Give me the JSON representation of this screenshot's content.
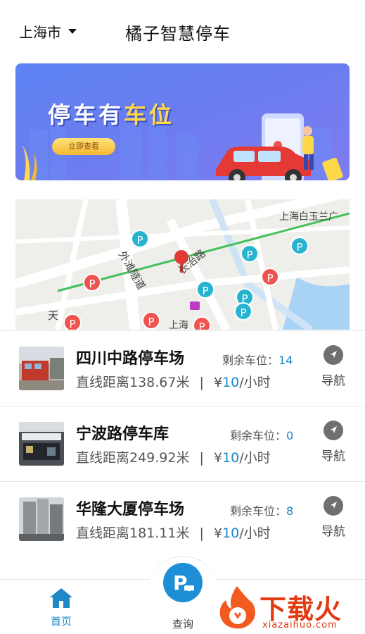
{
  "header": {
    "city": "上海市",
    "title": "橘子智慧停车"
  },
  "banner": {
    "title_part1": "停车有",
    "title_part2": "车位",
    "button": "立即查看"
  },
  "map": {
    "labels": [
      "上海白玉兰广",
      "长治路",
      "外滩隧道",
      "天",
      "上海"
    ]
  },
  "parking_list": [
    {
      "name": "四川中路停车场",
      "distance": "直线距离138.67米",
      "separator": "|",
      "price_prefix": "¥",
      "price": "10",
      "price_unit": "/小时",
      "avail_label": "剩余车位：",
      "avail_value": "14",
      "nav_label": "导航"
    },
    {
      "name": "宁波路停车库",
      "distance": "直线距离249.92米",
      "separator": "|",
      "price_prefix": "¥",
      "price": "10",
      "price_unit": "/小时",
      "avail_label": "剩余车位：",
      "avail_value": "0",
      "nav_label": "导航"
    },
    {
      "name": "华隆大厦停车场",
      "distance": "直线距离181.11米",
      "separator": "|",
      "price_prefix": "¥",
      "price": "10",
      "price_unit": "/小时",
      "avail_label": "剩余车位：",
      "avail_value": "8",
      "nav_label": "导航"
    }
  ],
  "bottom_nav": {
    "home_label": "首页",
    "query_label": "查询"
  },
  "watermark": {
    "text": "下载火",
    "url": "xiazaihuo.com"
  },
  "colors": {
    "accent": "#1e88c8",
    "parking_pin_red": "#ef5350",
    "parking_pin_teal": "#26b3cf"
  }
}
